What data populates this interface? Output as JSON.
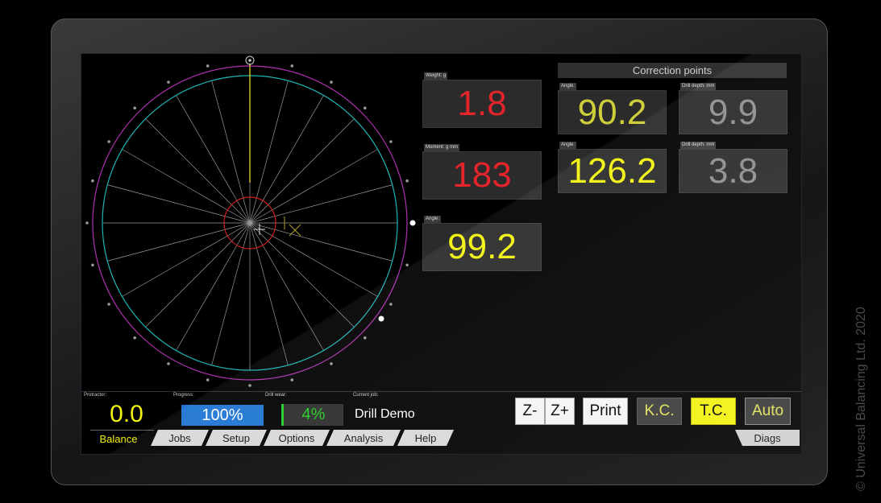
{
  "readouts": {
    "weight": {
      "label": "Weight:  g",
      "value": "1.8"
    },
    "moment": {
      "label": "Moment:  g mm",
      "value": "183"
    },
    "angle": {
      "label": "Angle:",
      "value": "99.2"
    }
  },
  "correction_points": {
    "title": "Correction points",
    "points": [
      {
        "angle_label": "Angle:",
        "angle": "90.2",
        "depth_label": "Drill depth:  mm",
        "depth": "9.9"
      },
      {
        "angle_label": "Angle:",
        "angle": "126.2",
        "depth_label": "Drill depth:  mm",
        "depth": "3.8"
      }
    ]
  },
  "status": {
    "protractor_label": "Protractor:",
    "protractor_value": "0.0",
    "progress_label": "Progress:",
    "progress_value": "100%",
    "drill_wear_label": "Drill wear:",
    "drill_wear_value": "4%",
    "current_job_label": "Current job:",
    "current_job_value": "Drill Demo"
  },
  "buttons": {
    "z_minus": "Z-",
    "z_plus": "Z+",
    "print": "Print",
    "kc": "K.C.",
    "tc": "T.C.",
    "auto": "Auto"
  },
  "tabs": [
    "Balance",
    "Jobs",
    "Setup",
    "Options",
    "Analysis",
    "Help"
  ],
  "right_tab": "Diags",
  "active_tab": "Balance",
  "copyright": "© Universal Balancing Ltd. 2020",
  "colors": {
    "value_red": "#e3242b",
    "value_yellow": "#f2f210",
    "value_grey": "#8e8e8e",
    "progress_blue": "#1c74d1",
    "wear_green": "#22cc22",
    "outer_ring": "#b030b0",
    "inner_ring": "#1fb3b3",
    "center_ring": "#d02020"
  },
  "dial": {
    "spokes": 24,
    "indicator": "unbalance vector marker"
  }
}
